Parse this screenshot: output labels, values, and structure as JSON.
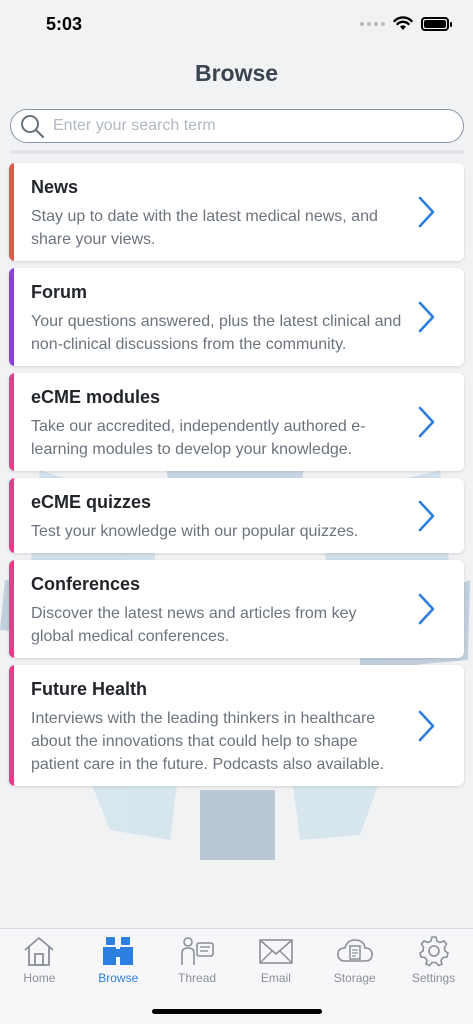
{
  "status": {
    "time": "5:03"
  },
  "header": {
    "title": "Browse"
  },
  "search": {
    "placeholder": "Enter your search term",
    "value": ""
  },
  "colors": {
    "news": "#e5574a",
    "forum": "#8a3fe8",
    "pink": "#e83c8a",
    "accent": "#2c7fe0"
  },
  "cards": [
    {
      "title": "News",
      "description": "Stay up to date with the latest medical news, and share your views."
    },
    {
      "title": "Forum",
      "description": "Your questions answered, plus the latest clinical and non-clinical discussions from the community."
    },
    {
      "title": "eCME modules",
      "description": "Take our accredited, independently authored e-learning modules to develop your knowledge."
    },
    {
      "title": "eCME quizzes",
      "description": "Test your knowledge with our popular quizzes."
    },
    {
      "title": "Conferences",
      "description": "Discover the latest news and articles from key global medical conferences."
    },
    {
      "title": "Future Health",
      "description": "Interviews with the leading thinkers in healthcare about the innovations that could help to shape patient care in the future. Podcasts also available."
    }
  ],
  "tabs": [
    {
      "label": "Home",
      "icon": "home-icon"
    },
    {
      "label": "Browse",
      "icon": "binoculars-icon",
      "active": true
    },
    {
      "label": "Thread",
      "icon": "thread-icon"
    },
    {
      "label": "Email",
      "icon": "envelope-icon"
    },
    {
      "label": "Storage",
      "icon": "cloud-storage-icon"
    },
    {
      "label": "Settings",
      "icon": "gear-icon"
    }
  ]
}
